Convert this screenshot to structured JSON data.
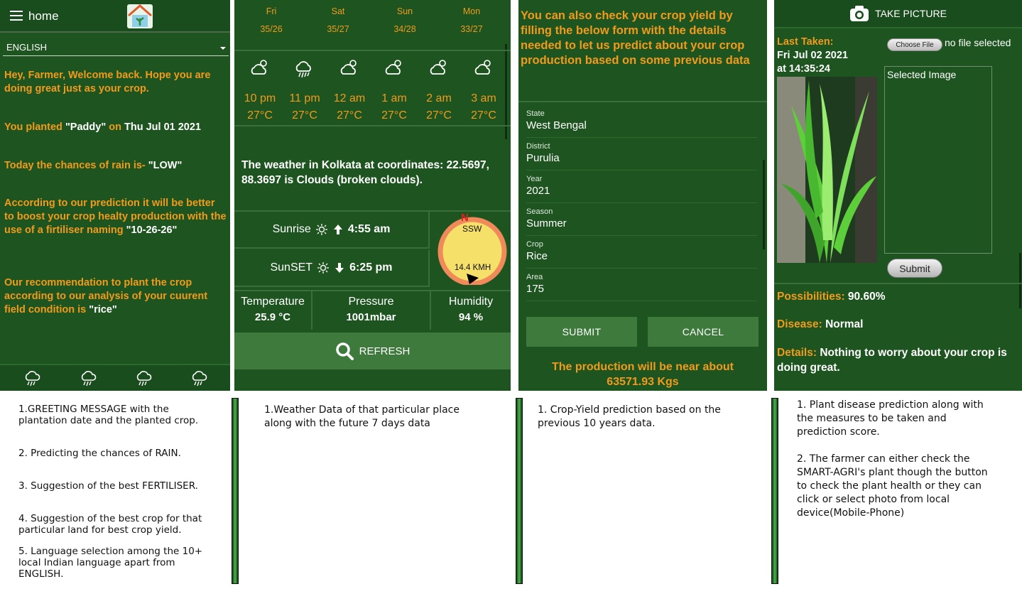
{
  "panel1": {
    "title": "home",
    "language": "ENGLISH",
    "greeting": "Hey, Farmer, Welcome back. Hope you are doing great just as your crop.",
    "planted_prefix": "You planted ",
    "planted_crop": "\"Paddy\"",
    "planted_on": " on ",
    "planted_date": "Thu Jul 01 2021",
    "rain_prefix": "Today the chances of rain is- ",
    "rain_value": "\"LOW\"",
    "fertiliser_prefix": "According to our prediction it will be better to boost your crop healty production with the use of a firtiliser naming ",
    "fertiliser_value": "\"10-26-26\"",
    "recommend_prefix": "Our recommendation to plant the crop according to our analysis of your cuurent field condition is ",
    "recommend_value": "\"rice\""
  },
  "panel2": {
    "days": [
      {
        "day": "Fri",
        "temp": "35/26"
      },
      {
        "day": "Sat",
        "temp": "35/27"
      },
      {
        "day": "Sun",
        "temp": "34/28"
      },
      {
        "day": "Mon",
        "temp": "33/27"
      }
    ],
    "hours": [
      {
        "time": "10 pm",
        "temp": "27°C",
        "icon": "cloud-icon"
      },
      {
        "time": "11 pm",
        "temp": "27°C",
        "icon": "rain-cloud-icon"
      },
      {
        "time": "12 am",
        "temp": "27°C",
        "icon": "cloud-icon"
      },
      {
        "time": "1 am",
        "temp": "27°C",
        "icon": "cloud-icon"
      },
      {
        "time": "2 am",
        "temp": "27°C",
        "icon": "cloud-icon"
      },
      {
        "time": "3 am",
        "temp": "27°C",
        "icon": "cloud-icon"
      }
    ],
    "description": "The weather in Kolkata at coordinates: 22.5697, 88.3697 is Clouds (broken clouds).",
    "sunrise_label": "Sunrise",
    "sunrise_time": "4:55 am",
    "sunset_label": "SunSET",
    "sunset_time": "6:25 pm",
    "compass_north": "N",
    "wind_direction": "SSW",
    "wind_speed": "14.4 KMH",
    "temperature_label": "Temperature",
    "temperature_value": "25.9 °C",
    "pressure_label": "Pressure",
    "pressure_value": "1001mbar",
    "humidity_label": "Humidity",
    "humidity_value": "94 %",
    "refresh_label": "REFRESH"
  },
  "panel3": {
    "intro": "You can also check your crop yield by filling the below form with the details needed to let us predict about your crop production based on some previous data",
    "fields": [
      {
        "label": "State",
        "value": "West Bengal"
      },
      {
        "label": "District",
        "value": "Purulia"
      },
      {
        "label": "Year",
        "value": "2021"
      },
      {
        "label": "Season",
        "value": "Summer"
      },
      {
        "label": "Crop",
        "value": "Rice"
      },
      {
        "label": "Area",
        "value": "175"
      }
    ],
    "submit_label": "SUBMIT",
    "cancel_label": "CANCEL",
    "result_line1": "The production will be near about",
    "result_line2": "63571.93 Kgs"
  },
  "panel4": {
    "take_picture_label": "TAKE PICTURE",
    "last_taken_label": "Last Taken:",
    "last_taken_date": "Fri Jul 02 2021",
    "last_taken_time": "at 14:35:24",
    "choose_file_label": "Choose File",
    "no_file_text": "no file selected",
    "selected_image_label": "Selected Image",
    "submit_label": "Submit",
    "possibilities_label": "Possibilities: ",
    "possibilities_value": "90.60%",
    "disease_label": "Disease: ",
    "disease_value": "Normal",
    "details_label": "Details: ",
    "details_value": "Nothing to worry about your crop is doing great."
  },
  "captions": {
    "c1_1": "1.GREETING MESSAGE with the\nplantation date and the planted crop.",
    "c1_2": "2. Predicting the chances of RAIN.",
    "c1_3": "3. Suggestion of the best FERTILISER.",
    "c1_4": "4. Suggestion of the best crop for that\n particular land for best crop yield.",
    "c1_5": "5. Language selection among the 10+\nlocal Indian language apart from\nENGLISH.",
    "c2": "1.Weather Data of that particular place\nalong with the future 7 days data",
    "c3": "1. Crop-Yield prediction based on the\nprevious 10 years data.",
    "c4_1": "1. Plant disease prediction along with\nthe measures to be taken and\nprediction score.",
    "c4_2": "2. The farmer can either check the\nSMART-AGRI's plant though the button\nto check the plant health or they can\nclick or select photo from local\ndevice(Mobile-Phone)"
  }
}
